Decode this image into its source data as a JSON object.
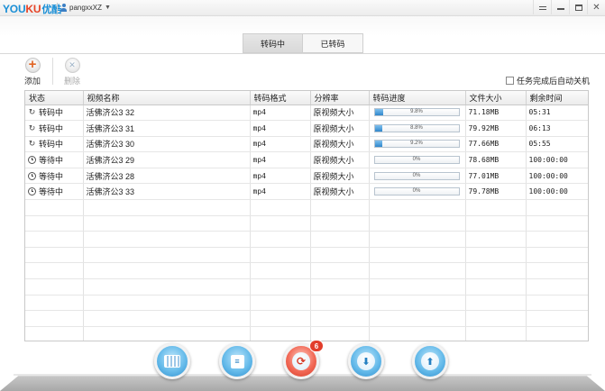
{
  "app": {
    "logo_you": "YOU",
    "logo_ku": "KU",
    "logo_cn": "优酷",
    "username": "pangxxXZ"
  },
  "tabs": [
    {
      "label": "转码中",
      "active": true
    },
    {
      "label": "已转码",
      "active": false
    }
  ],
  "toolbar": {
    "add_label": "添加",
    "delete_label": "删除",
    "auto_shutdown_label": "任务完成后自动关机",
    "auto_shutdown_checked": false
  },
  "table": {
    "columns": [
      "状态",
      "视频名称",
      "转码格式",
      "分辨率",
      "转码进度",
      "文件大小",
      "剩余时间"
    ],
    "rows": [
      {
        "status": "转码中",
        "status_icon": "refresh-icon",
        "name": "活佛济公3 32",
        "format": "mp4",
        "resolution": "原视频大小",
        "progress": 9.8,
        "progress_text": "9.8%",
        "size": "71.18MB",
        "remaining": "05:31"
      },
      {
        "status": "转码中",
        "status_icon": "refresh-icon",
        "name": "活佛济公3 31",
        "format": "mp4",
        "resolution": "原视频大小",
        "progress": 8.8,
        "progress_text": "8.8%",
        "size": "79.92MB",
        "remaining": "06:13"
      },
      {
        "status": "转码中",
        "status_icon": "refresh-icon",
        "name": "活佛济公3 30",
        "format": "mp4",
        "resolution": "原视频大小",
        "progress": 9.2,
        "progress_text": "9.2%",
        "size": "77.66MB",
        "remaining": "05:55"
      },
      {
        "status": "等待中",
        "status_icon": "clock-icon",
        "name": "活佛济公3 29",
        "format": "mp4",
        "resolution": "原视频大小",
        "progress": 0,
        "progress_text": "0%",
        "size": "78.68MB",
        "remaining": "100:00:00"
      },
      {
        "status": "等待中",
        "status_icon": "clock-icon",
        "name": "活佛济公3 28",
        "format": "mp4",
        "resolution": "原视频大小",
        "progress": 0,
        "progress_text": "0%",
        "size": "77.01MB",
        "remaining": "100:00:00"
      },
      {
        "status": "等待中",
        "status_icon": "clock-icon",
        "name": "活佛济公3 33",
        "format": "mp4",
        "resolution": "原视频大小",
        "progress": 0,
        "progress_text": "0%",
        "size": "79.78MB",
        "remaining": "100:00:00"
      }
    ]
  },
  "dock": {
    "buttons": [
      "film-icon",
      "edit-list-icon",
      "convert-icon",
      "download-icon",
      "upload-icon"
    ],
    "convert_badge": "6"
  },
  "colors": {
    "brand_blue": "#1a8fd6",
    "brand_red": "#e64326",
    "progress_fill": "#2f87cc",
    "badge_red": "#e23d2b"
  }
}
